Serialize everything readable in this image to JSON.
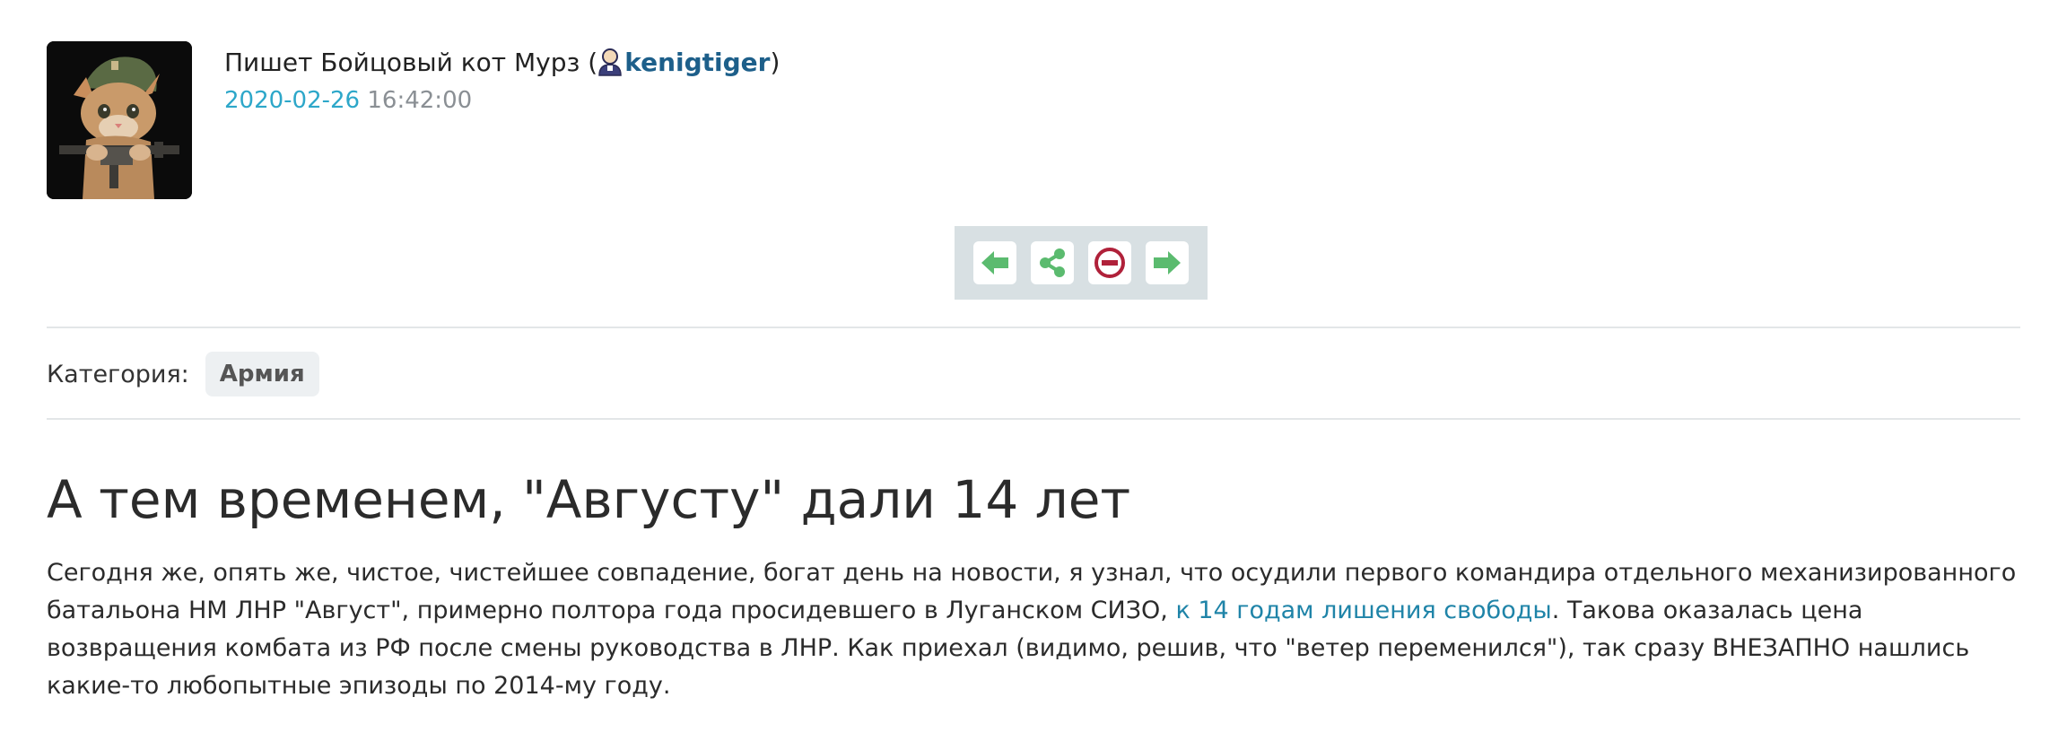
{
  "post": {
    "author_prefix": "Пишет Бойцовый кот Мурз (",
    "username": "kenigtiger",
    "author_suffix": ")",
    "date": "2020-02-26",
    "time": "16:42:00"
  },
  "toolbar": {
    "buttons": [
      {
        "name": "previous",
        "icon": "arrow-left-icon",
        "color": "#5bbb6f"
      },
      {
        "name": "share",
        "icon": "share-icon",
        "color": "#5bbb6f"
      },
      {
        "name": "block",
        "icon": "no-entry-icon",
        "color": "#b0213a"
      },
      {
        "name": "next",
        "icon": "arrow-right-icon",
        "color": "#5bbb6f"
      }
    ]
  },
  "category": {
    "label": "Категория:",
    "tag": "Армия"
  },
  "article": {
    "title": "А тем временем, \"Августу\" дали 14 лет",
    "p1_before": "Сегодня же, опять же, чистое, чистейшее совпадение, богат день на новости, я узнал, что осудили первого командира отдельного механизированного батальона НМ ЛНР \"Август\", примерно полтора года просидевшего в Луганском СИЗО, ",
    "p1_link": "к 14 годам лишения свободы",
    "p1_after": ". Такова оказалась цена возвращения комбата из РФ после смены руководства в ЛНР. Как приехал (видимо, решив, что \"ветер переменился\"), так сразу ВНЕЗАПНО нашлись какие-то любопытные эпизоды по 2014-му году."
  },
  "colors": {
    "link": "#1f84a8",
    "date": "#2da7c9",
    "toolbar_bg": "#d8e0e3",
    "icon_green": "#5bbb6f",
    "icon_red": "#b0213a"
  }
}
